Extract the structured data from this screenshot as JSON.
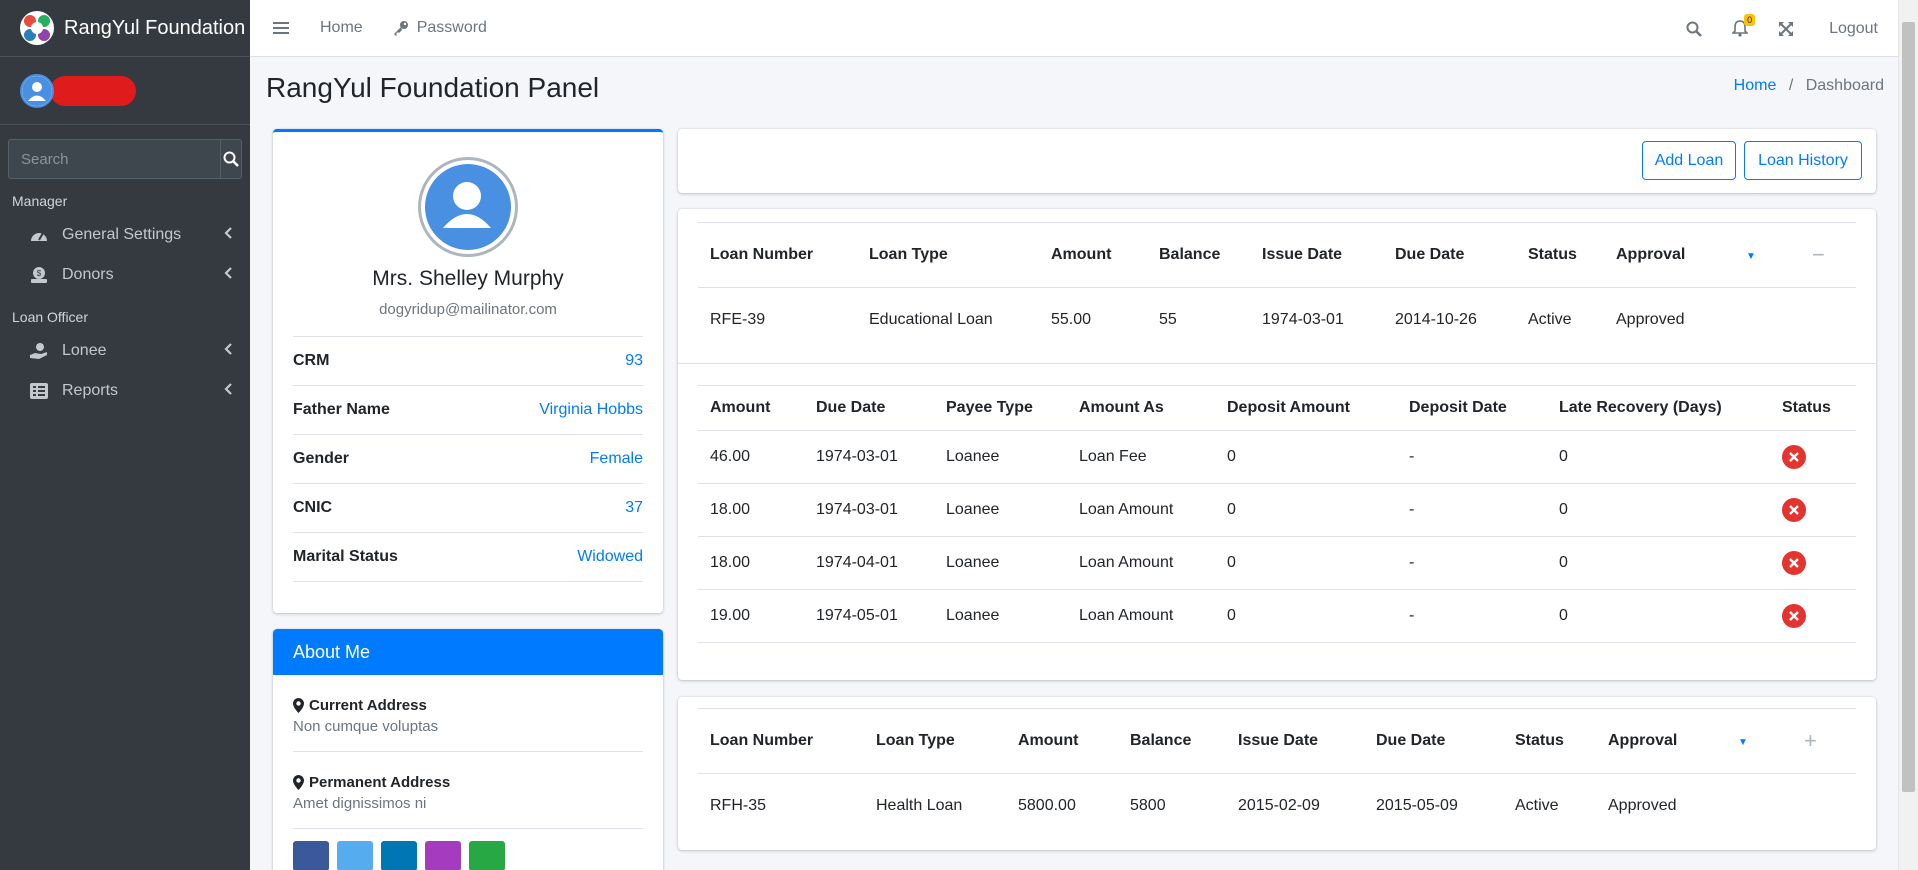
{
  "brand": {
    "name": "RangYul Foundation"
  },
  "sidebar": {
    "search_placeholder": "Search",
    "sections": [
      {
        "header": "Manager",
        "items": [
          {
            "label": "General Settings",
            "icon": "tachometer-icon"
          },
          {
            "label": "Donors",
            "icon": "donate-icon"
          }
        ]
      },
      {
        "header": "Loan Officer",
        "items": [
          {
            "label": "Lonee",
            "icon": "hand-holding-icon"
          },
          {
            "label": "Reports",
            "icon": "list-alt-icon"
          }
        ]
      }
    ]
  },
  "topbar": {
    "home": "Home",
    "password": "Password",
    "notification_count": "0",
    "logout": "Logout"
  },
  "page": {
    "title": "RangYul Foundation Panel",
    "breadcrumb": {
      "home": "Home",
      "current": "Dashboard"
    }
  },
  "profile": {
    "name": "Mrs. Shelley Murphy",
    "email": "dogyridup@mailinator.com",
    "fields": [
      {
        "label": "CRM",
        "value": "93"
      },
      {
        "label": "Father Name",
        "value": "Virginia Hobbs"
      },
      {
        "label": "Gender",
        "value": "Female"
      },
      {
        "label": "CNIC",
        "value": "37"
      },
      {
        "label": "Marital Status",
        "value": "Widowed"
      }
    ]
  },
  "about": {
    "title": "About Me",
    "current_address_label": "Current Address",
    "current_address": "Non cumque voluptas",
    "permanent_address_label": "Permanent Address",
    "permanent_address": "Amet dignissimos ni"
  },
  "actions": {
    "add_loan": "Add Loan",
    "loan_history": "Loan History"
  },
  "loan_headers": [
    "Loan Number",
    "Loan Type",
    "Amount",
    "Balance",
    "Issue Date",
    "Due Date",
    "Status",
    "Approval"
  ],
  "loans": [
    {
      "number": "RFE-39",
      "type": "Educational Loan",
      "amount": "55.00",
      "balance": "55",
      "issue_date": "1974-03-01",
      "due_date": "2014-10-26",
      "status": "Active",
      "approval": "Approved",
      "toggle": "−"
    },
    {
      "number": "RFH-35",
      "type": "Health Loan",
      "amount": "5800.00",
      "balance": "5800",
      "issue_date": "2015-02-09",
      "due_date": "2015-05-09",
      "status": "Active",
      "approval": "Approved",
      "toggle": "+"
    }
  ],
  "installment_headers": [
    "Amount",
    "Due Date",
    "Payee Type",
    "Amount As",
    "Deposit Amount",
    "Deposit Date",
    "Late Recovery (Days)",
    "Status"
  ],
  "installments": [
    {
      "amount": "46.00",
      "due_date": "1974-03-01",
      "payee": "Loanee",
      "amount_as": "Loan Fee",
      "deposit_amount": "0",
      "deposit_date": "-",
      "late": "0"
    },
    {
      "amount": "18.00",
      "due_date": "1974-03-01",
      "payee": "Loanee",
      "amount_as": "Loan Amount",
      "deposit_amount": "0",
      "deposit_date": "-",
      "late": "0"
    },
    {
      "amount": "18.00",
      "due_date": "1974-04-01",
      "payee": "Loanee",
      "amount_as": "Loan Amount",
      "deposit_amount": "0",
      "deposit_date": "-",
      "late": "0"
    },
    {
      "amount": "19.00",
      "due_date": "1974-05-01",
      "payee": "Loanee",
      "amount_as": "Loan Amount",
      "deposit_amount": "0",
      "deposit_date": "-",
      "late": "0"
    }
  ],
  "colors": {
    "sidebar": "#343a40",
    "primary": "#007bff",
    "danger": "#e3342f",
    "warning": "#ffc107"
  }
}
